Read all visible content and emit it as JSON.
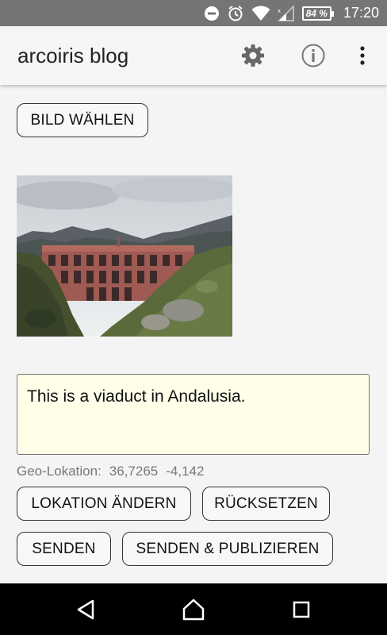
{
  "status_bar": {
    "battery": "84 %",
    "time": "17:20",
    "icons": [
      "do-not-disturb-icon",
      "alarm-icon",
      "wifi-icon",
      "cell-signal-icon",
      "battery-icon"
    ]
  },
  "app_bar": {
    "title": "arcoiris blog",
    "icons": [
      "settings-icon",
      "info-icon",
      "more-vert-icon"
    ]
  },
  "main": {
    "choose_image_label": "BILD WÄHLEN",
    "description_text": "This is a viaduct in Andalusia.",
    "geo": {
      "label": "Geo-Lokation:",
      "lat": "36,7265",
      "lon": "-4,142"
    },
    "buttons": {
      "change_location": "LOKATION ÄNDERN",
      "reset": "RÜCKSETZEN",
      "send": "SENDEN",
      "send_publish": "SENDEN & PUBLIZIEREN"
    }
  },
  "nav_bar": {
    "icons": [
      "back-icon",
      "home-icon",
      "recents-icon"
    ]
  },
  "colors": {
    "status_bar": "#757575",
    "app_bar": "#f6f6f6",
    "background": "#f4f4f4",
    "text_area": "#fefee9",
    "nav_bar": "#000000"
  }
}
